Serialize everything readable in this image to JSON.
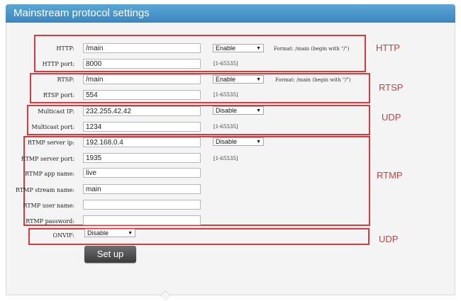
{
  "header": {
    "title": "Mainstream protocol settings"
  },
  "http": {
    "path_label": "HTTP:",
    "path_value": "/main",
    "mode": "Enable",
    "format_hint": "Format: /main (begin with \"/\")",
    "port_label": "HTTP port:",
    "port_value": "8000",
    "port_range": "[1-65535]",
    "tag": "HTTP"
  },
  "rtsp": {
    "path_label": "RTSP:",
    "path_value": "/main",
    "mode": "Enable",
    "format_hint": "Format: /main (begin with \"/\")",
    "port_label": "RTSP port:",
    "port_value": "554",
    "port_range": "[1-65535]",
    "tag": "RTSP"
  },
  "multicast": {
    "ip_label": "Multicast IP:",
    "ip_value": "232.255.42.42",
    "mode": "Disable",
    "port_label": "Multicast port:",
    "port_value": "1234",
    "port_range": "[1-65535]",
    "tag": "UDP"
  },
  "rtmp": {
    "server_ip_label": "RTMP server ip:",
    "server_ip_value": "192.168.0.4",
    "mode": "Disable",
    "server_port_label": "RTMP server port:",
    "server_port_value": "1935",
    "port_range": "[1-65535]",
    "app_name_label": "RTMP app name:",
    "app_name_value": "live",
    "stream_name_label": "RTMP stream name:",
    "stream_name_value": "main",
    "user_name_label": "RTMP user name:",
    "user_name_value": "",
    "password_label": "RTMP password:",
    "password_value": "",
    "tag": "RTMP"
  },
  "onvif": {
    "label": "ONVIF:",
    "mode": "Disable",
    "tag": "UDP"
  },
  "actions": {
    "setup_label": "Set up"
  },
  "colors": {
    "header": "#3b86bf",
    "annotation": "#d8393c",
    "button": "#4a4a4a"
  },
  "icons": {
    "dropdown": "dropdown-arrow-icon"
  }
}
